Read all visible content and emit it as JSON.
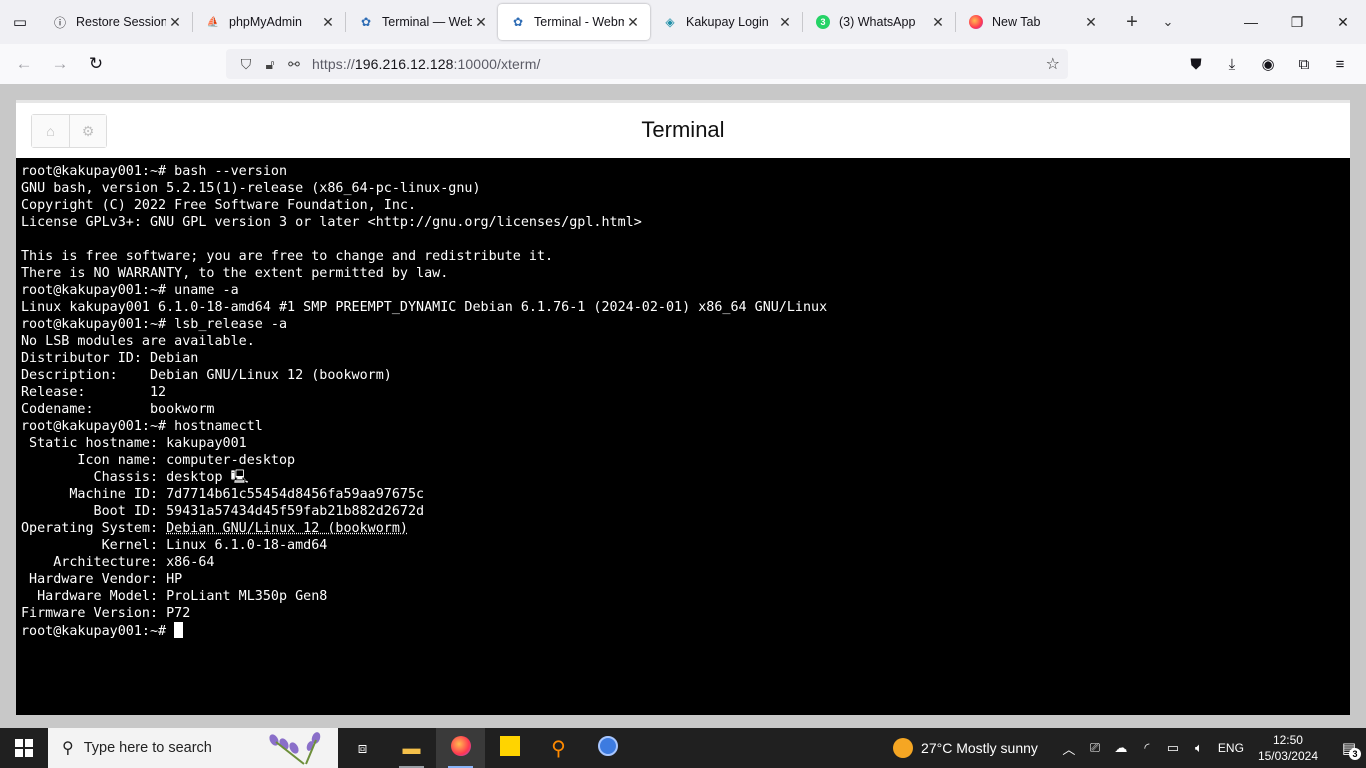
{
  "tabs": [
    {
      "title": "Restore Session",
      "icon": "info-icon",
      "active": false
    },
    {
      "title": "phpMyAdmin",
      "icon": "phpmyadmin-icon",
      "active": false
    },
    {
      "title": "Terminal — Webmin",
      "icon": "webmin-icon",
      "active": false
    },
    {
      "title": "Terminal - Webmin",
      "icon": "webmin-icon",
      "active": true
    },
    {
      "title": "Kakupay Login",
      "icon": "kakupay-icon",
      "active": false
    },
    {
      "title": "(3) WhatsApp",
      "icon": "whatsapp-icon",
      "active": false
    },
    {
      "title": "New Tab",
      "icon": "firefox-icon",
      "active": false
    }
  ],
  "urlbar": {
    "scheme": "https://",
    "host": "196.216.12.128",
    "rest": ":10000/xterm/"
  },
  "page": {
    "title": "Terminal"
  },
  "terminal": {
    "lines": [
      "root@kakupay001:~# bash --version",
      "GNU bash, version 5.2.15(1)-release (x86_64-pc-linux-gnu)",
      "Copyright (C) 2022 Free Software Foundation, Inc.",
      "License GPLv3+: GNU GPL version 3 or later <http://gnu.org/licenses/gpl.html>",
      "",
      "This is free software; you are free to change and redistribute it.",
      "There is NO WARRANTY, to the extent permitted by law.",
      "root@kakupay001:~# uname -a",
      "Linux kakupay001 6.1.0-18-amd64 #1 SMP PREEMPT_DYNAMIC Debian 6.1.76-1 (2024-02-01) x86_64 GNU/Linux",
      "root@kakupay001:~# lsb_release -a",
      "No LSB modules are available.",
      "Distributor ID: Debian",
      "Description:    Debian GNU/Linux 12 (bookworm)",
      "Release:        12",
      "Codename:       bookworm",
      "root@kakupay001:~# hostnamectl",
      " Static hostname: kakupay001",
      "       Icon name: computer-desktop",
      "         Chassis: desktop 🖳",
      "      Machine ID: 7d7714b61c55454d8456fa59aa97675c",
      "         Boot ID: 59431a57434d45f59fab21b882d2672d",
      "Operating System: Debian GNU/Linux 12 (bookworm)",
      "          Kernel: Linux 6.1.0-18-amd64",
      "    Architecture: x86-64",
      " Hardware Vendor: HP",
      "  Hardware Model: ProLiant ML350p Gen8",
      "Firmware Version: P72"
    ],
    "prompt": "root@kakupay001:~# "
  },
  "taskbar": {
    "search_placeholder": "Type here to search",
    "weather": "27°C  Mostly sunny",
    "language": "ENG",
    "time": "12:50",
    "date": "15/03/2024",
    "notification_count": "3"
  }
}
